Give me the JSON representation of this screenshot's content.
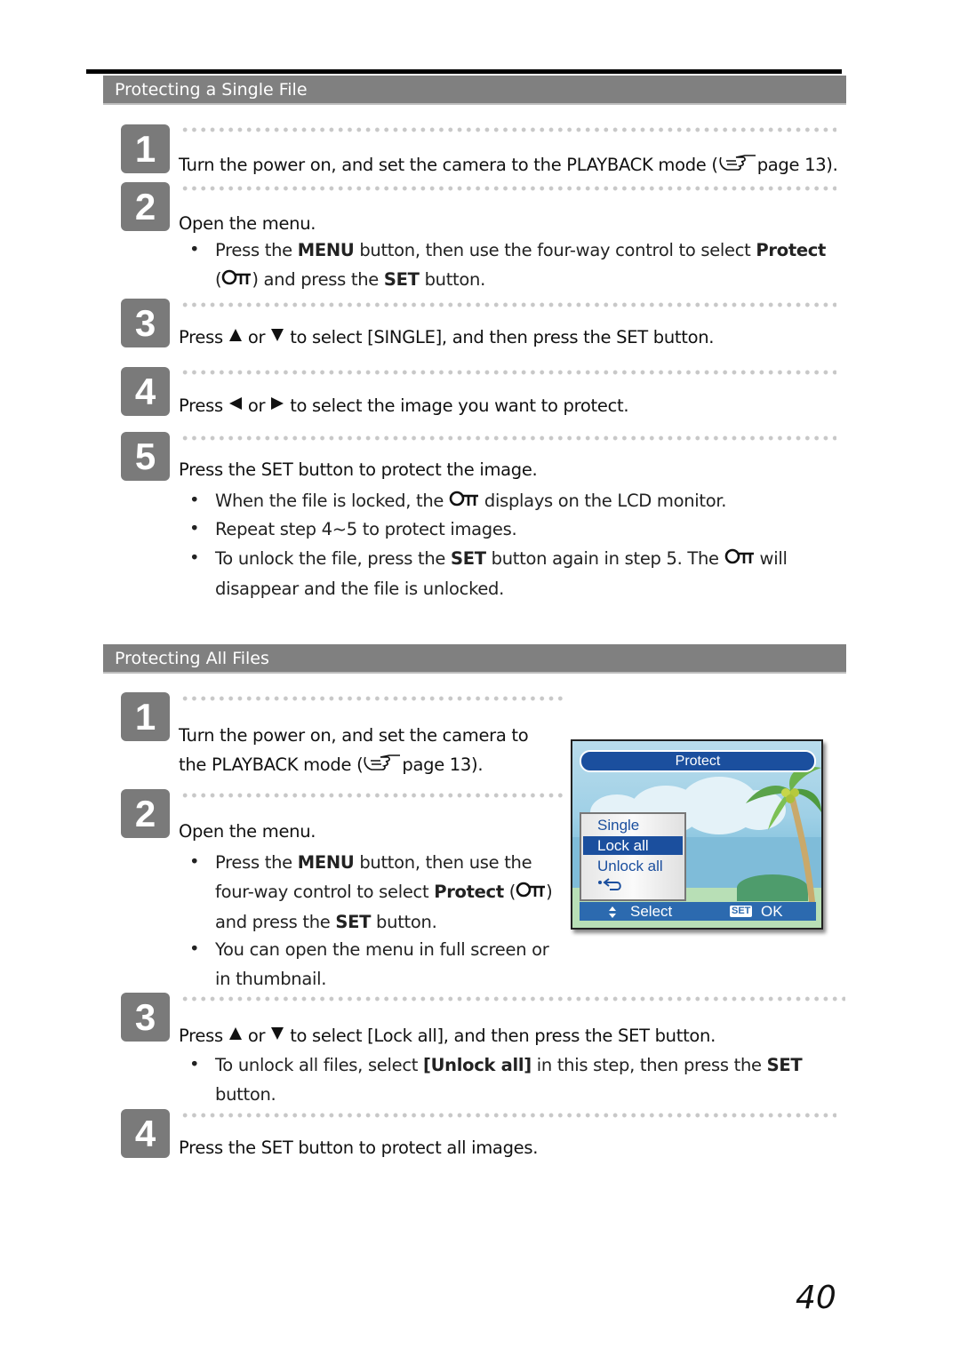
{
  "sections": [
    {
      "title": "Protecting a Single File",
      "steps": [
        {
          "number": "1",
          "title_pre": "Turn the power on, and set the camera to the PLAYBACK mode (",
          "title_post": "page 13)."
        },
        {
          "number": "2",
          "title": "Open the menu.",
          "bullets": [
            {
              "line1_a": "Press the ",
              "line1_b": "MENU",
              "line1_c": " button, then use the four-way control to select ",
              "line1_d": "Protect",
              "line2_a": "(",
              "line2_b": ") and press the ",
              "line2_c": "SET",
              "line2_d": " button."
            }
          ]
        },
        {
          "number": "3",
          "title_a": "Press",
          "title_b": "or",
          "title_c": "to select [SINGLE], and then press the SET button."
        },
        {
          "number": "4",
          "title_a": "Press",
          "title_b": "or",
          "title_c": "to select the image you want to protect."
        },
        {
          "number": "5",
          "title": "Press the SET button to protect the image.",
          "bullets": [
            {
              "a": "When the file is locked, the ",
              "b": " displays on the LCD monitor."
            },
            {
              "a": "Repeat step 4~5 to protect images."
            },
            {
              "a": "To unlock the file, press the ",
              "b": "SET",
              "c": " button again in step 5. The ",
              "d": " will",
              "e": "disappear and the file is unlocked."
            }
          ]
        }
      ]
    },
    {
      "title": "Protecting All Files",
      "steps": [
        {
          "number": "1",
          "title_line1": "Turn the power on, and set the camera to",
          "title_line2_pre": "the PLAYBACK mode (",
          "title_line2_post": "page 13)."
        },
        {
          "number": "2",
          "title": "Open the menu.",
          "bullets": [
            {
              "l1a": "Press the ",
              "l1b": "MENU",
              "l1c": " button, then use the",
              "l2a": "four-way control to select ",
              "l2b": "Protect",
              "l2c": " (",
              "l2d": ")",
              "l3a": "and press the ",
              "l3b": "SET",
              "l3c": " button."
            },
            {
              "l1": "You can open the menu in full screen or",
              "l2": "in thumbnail."
            }
          ]
        },
        {
          "number": "3",
          "title_a": "Press",
          "title_b": "or",
          "title_c": "to select [Lock all], and then press the SET button.",
          "bullets": [
            {
              "a": "To unlock all files, select ",
              "b": "[Unlock all]",
              "c": " in this step, then press the ",
              "d": "SET",
              "e": "button."
            }
          ]
        },
        {
          "number": "4",
          "title": "Press the SET button to protect all images."
        }
      ]
    }
  ],
  "lcd": {
    "title": "Protect",
    "menu_items": [
      "Single",
      "Lock all",
      "Unlock all"
    ],
    "selected_item": "Lock all",
    "back_icon": "return-arrow-icon",
    "footer_select": "Select",
    "footer_set_badge": "SET",
    "footer_ok": "OK"
  },
  "icons": {
    "lock": "key-lock-icon",
    "hand": "pointing-hand-icon",
    "up": "up-triangle-icon",
    "down": "down-triangle-icon",
    "left": "left-triangle-icon",
    "right": "right-triangle-icon"
  },
  "page_number": "40",
  "colors": {
    "header_bg": "#808080",
    "badge_bg": "#7a7a7a",
    "lcd_blue": "#1b4f9e"
  }
}
